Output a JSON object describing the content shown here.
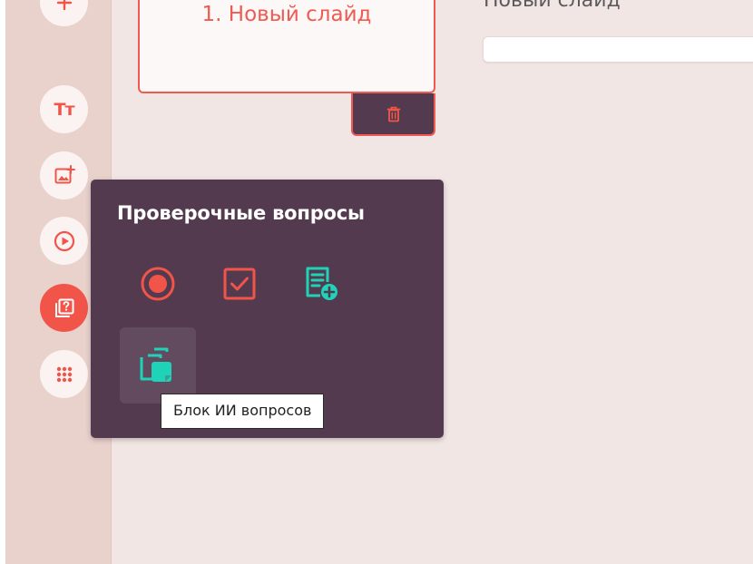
{
  "slides": {
    "items": [
      {
        "label": "1. Новый слайд"
      }
    ]
  },
  "main": {
    "slide_title": "Новый слайд"
  },
  "toolbar": {
    "tools": [
      {
        "icon": "plus-icon"
      },
      {
        "icon": "text-icon",
        "glyph": "Тт"
      },
      {
        "icon": "image-add-icon"
      },
      {
        "icon": "video-play-icon"
      },
      {
        "icon": "question-card-icon",
        "active": true
      },
      {
        "icon": "apps-grid-icon"
      }
    ]
  },
  "popup": {
    "title": "Проверочные вопросы",
    "options": [
      {
        "icon": "radio-single-choice-icon"
      },
      {
        "icon": "checkbox-multiple-choice-icon"
      },
      {
        "icon": "text-answer-add-icon"
      },
      {
        "icon": "ai-questions-block-icon",
        "hovered": true
      }
    ],
    "tooltip": "Блок ИИ вопросов"
  },
  "colors": {
    "accent_red": "#f1554a",
    "accent_teal": "#1fd3b9",
    "popup_bg": "#543a4f",
    "sidebar_bg": "#e9d1cc",
    "canvas_bg": "#f2e6e4"
  }
}
